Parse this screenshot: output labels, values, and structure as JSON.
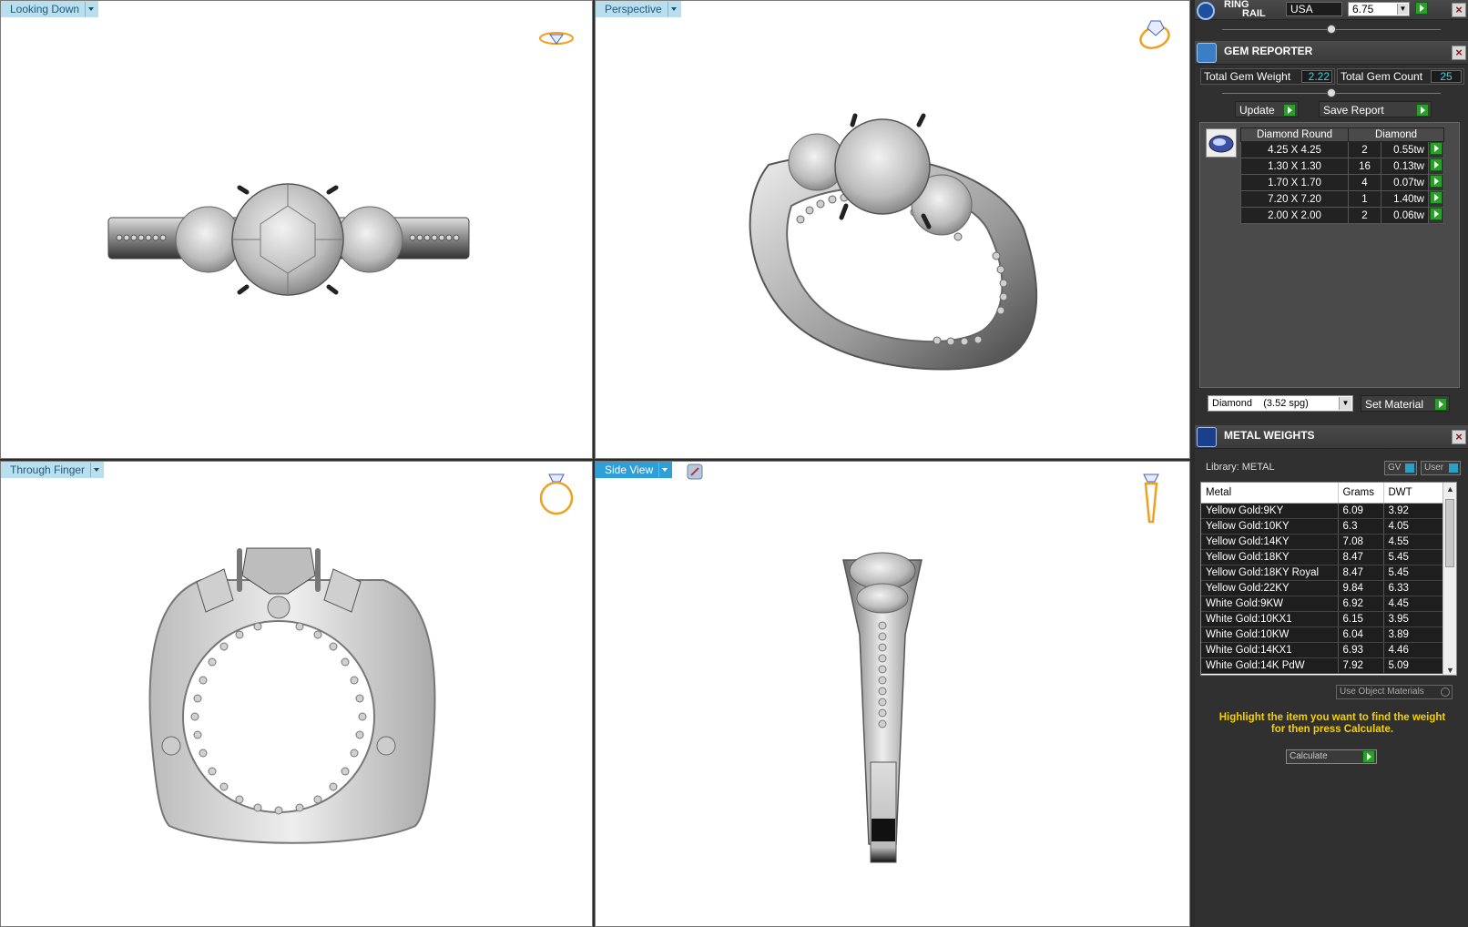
{
  "viewports": {
    "top": {
      "label": "Looking Down"
    },
    "perspective": {
      "label": "Perspective"
    },
    "finger": {
      "label": "Through Finger"
    },
    "side": {
      "label": "Side View"
    }
  },
  "ring_rail": {
    "title_line1": "RING",
    "title_line2": "RAIL",
    "country": "USA",
    "size": "6.75"
  },
  "gem_reporter": {
    "title": "GEM REPORTER",
    "total_weight_label": "Total Gem Weight",
    "total_weight_value": "2.22",
    "total_count_label": "Total Gem Count",
    "total_count_value": "25",
    "update_label": "Update",
    "save_label": "Save Report",
    "columns": [
      "Diamond Round",
      "Diamond"
    ],
    "rows": [
      {
        "size": "4.25 X 4.25",
        "count": "2",
        "weight": "0.55tw"
      },
      {
        "size": "1.30 X 1.30",
        "count": "16",
        "weight": "0.13tw"
      },
      {
        "size": "1.70 X 1.70",
        "count": "4",
        "weight": "0.07tw"
      },
      {
        "size": "7.20 X 7.20",
        "count": "1",
        "weight": "1.40tw"
      },
      {
        "size": "2.00 X 2.00",
        "count": "2",
        "weight": "0.06tw"
      }
    ],
    "material_select": "Diamond    (3.52 spg)",
    "set_material_label": "Set Material"
  },
  "metal_weights": {
    "title": "METAL WEIGHTS",
    "library_label": "Library: METAL",
    "gv_label": "GV",
    "user_label": "User",
    "columns": [
      "Metal",
      "Grams",
      "DWT"
    ],
    "rows": [
      {
        "metal": "Yellow Gold:9KY",
        "grams": "6.09",
        "dwt": "3.92"
      },
      {
        "metal": "Yellow Gold:10KY",
        "grams": "6.3",
        "dwt": "4.05"
      },
      {
        "metal": "Yellow Gold:14KY",
        "grams": "7.08",
        "dwt": "4.55"
      },
      {
        "metal": "Yellow Gold:18KY",
        "grams": "8.47",
        "dwt": "5.45"
      },
      {
        "metal": "Yellow Gold:18KY Royal",
        "grams": "8.47",
        "dwt": "5.45"
      },
      {
        "metal": "Yellow Gold:22KY",
        "grams": "9.84",
        "dwt": "6.33"
      },
      {
        "metal": "White Gold:9KW",
        "grams": "6.92",
        "dwt": "4.45"
      },
      {
        "metal": "White Gold:10KX1",
        "grams": "6.15",
        "dwt": "3.95"
      },
      {
        "metal": "White Gold:10KW",
        "grams": "6.04",
        "dwt": "3.89"
      },
      {
        "metal": "White Gold:14KX1",
        "grams": "6.93",
        "dwt": "4.46"
      },
      {
        "metal": "White Gold:14K PdW",
        "grams": "7.92",
        "dwt": "5.09"
      }
    ],
    "use_object_materials": "Use Object Materials",
    "hint": "Highlight the item you want to find the weight for then press Calculate.",
    "calculate_label": "Calculate"
  },
  "colors": {
    "accent_green": "#2aa02a",
    "value_cyan": "#3ad6e8",
    "hint_yellow": "#f5d000",
    "label_blue": "#b9dfee",
    "active_blue": "#2e9fd8"
  }
}
